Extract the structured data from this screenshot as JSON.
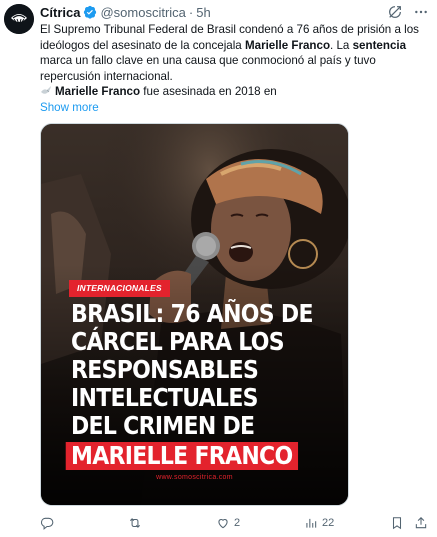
{
  "author": {
    "name": "Cítrica",
    "handle": "@somoscitrica",
    "separator": "·",
    "time": "5h"
  },
  "body": {
    "line1": "El Supremo Tribunal Federal de Brasil condenó a 76 años de prisión a los",
    "line2_pre": "ideólogos del asesinato de la concejala ",
    "line2_bold": "Marielle Franco",
    "line2_post": ". La ",
    "line2_bold2": "sentencia",
    "line3": "marca un fallo clave en una causa que conmocionó al país y tuvo",
    "line4": "repercusión internacional.",
    "line5_bold": "Marielle Franco",
    "line5_post": " fue asesinada en 2018 en",
    "show_more": "Show more"
  },
  "media": {
    "tag": "INTERNACIONALES",
    "headline_lines": [
      "BRASIL: 76 AÑOS DE",
      "CÁRCEL PARA LOS",
      "RESPONSABLES",
      "INTELECTUALES",
      "DEL CRIMEN DE"
    ],
    "headline_highlight": "MARIELLE FRANCO",
    "site": "www.somoscitrica.com"
  },
  "actions": {
    "reply_count": "",
    "retweet_count": "",
    "like_count": "2",
    "views_count": "22"
  },
  "icons": {
    "verified": "verified-badge-icon",
    "grok": "grok-icon",
    "more": "more-icon",
    "reply": "reply-icon",
    "retweet": "retweet-icon",
    "like": "like-icon",
    "views": "views-icon",
    "bookmark": "bookmark-icon",
    "share": "share-icon",
    "dove": "dove-icon"
  },
  "colors": {
    "accent": "#1d9bf0",
    "text": "#0f1419",
    "muted": "#536471",
    "brand_red": "#e3232d"
  }
}
